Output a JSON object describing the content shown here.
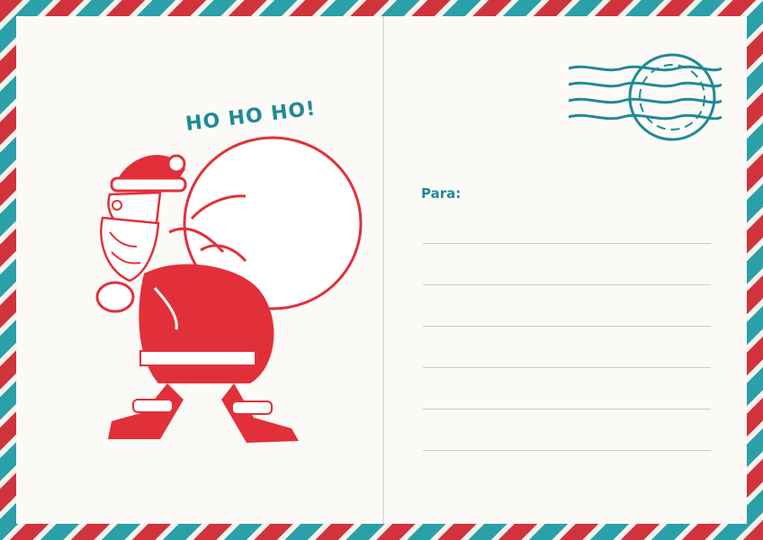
{
  "postcard": {
    "greeting": "HO HO HO!",
    "to_label": "Para:",
    "address_line_count": 6
  },
  "art": {
    "illustration": "santa-claus-carrying-sack-icon",
    "stamp": "postmark-cancellation-icon"
  },
  "colors": {
    "border_red": "#d1333d",
    "border_teal": "#2aa0a8",
    "santa_red": "#e2303a",
    "accent_teal": "#1f8a95",
    "card_background": "#fbfaf7"
  }
}
